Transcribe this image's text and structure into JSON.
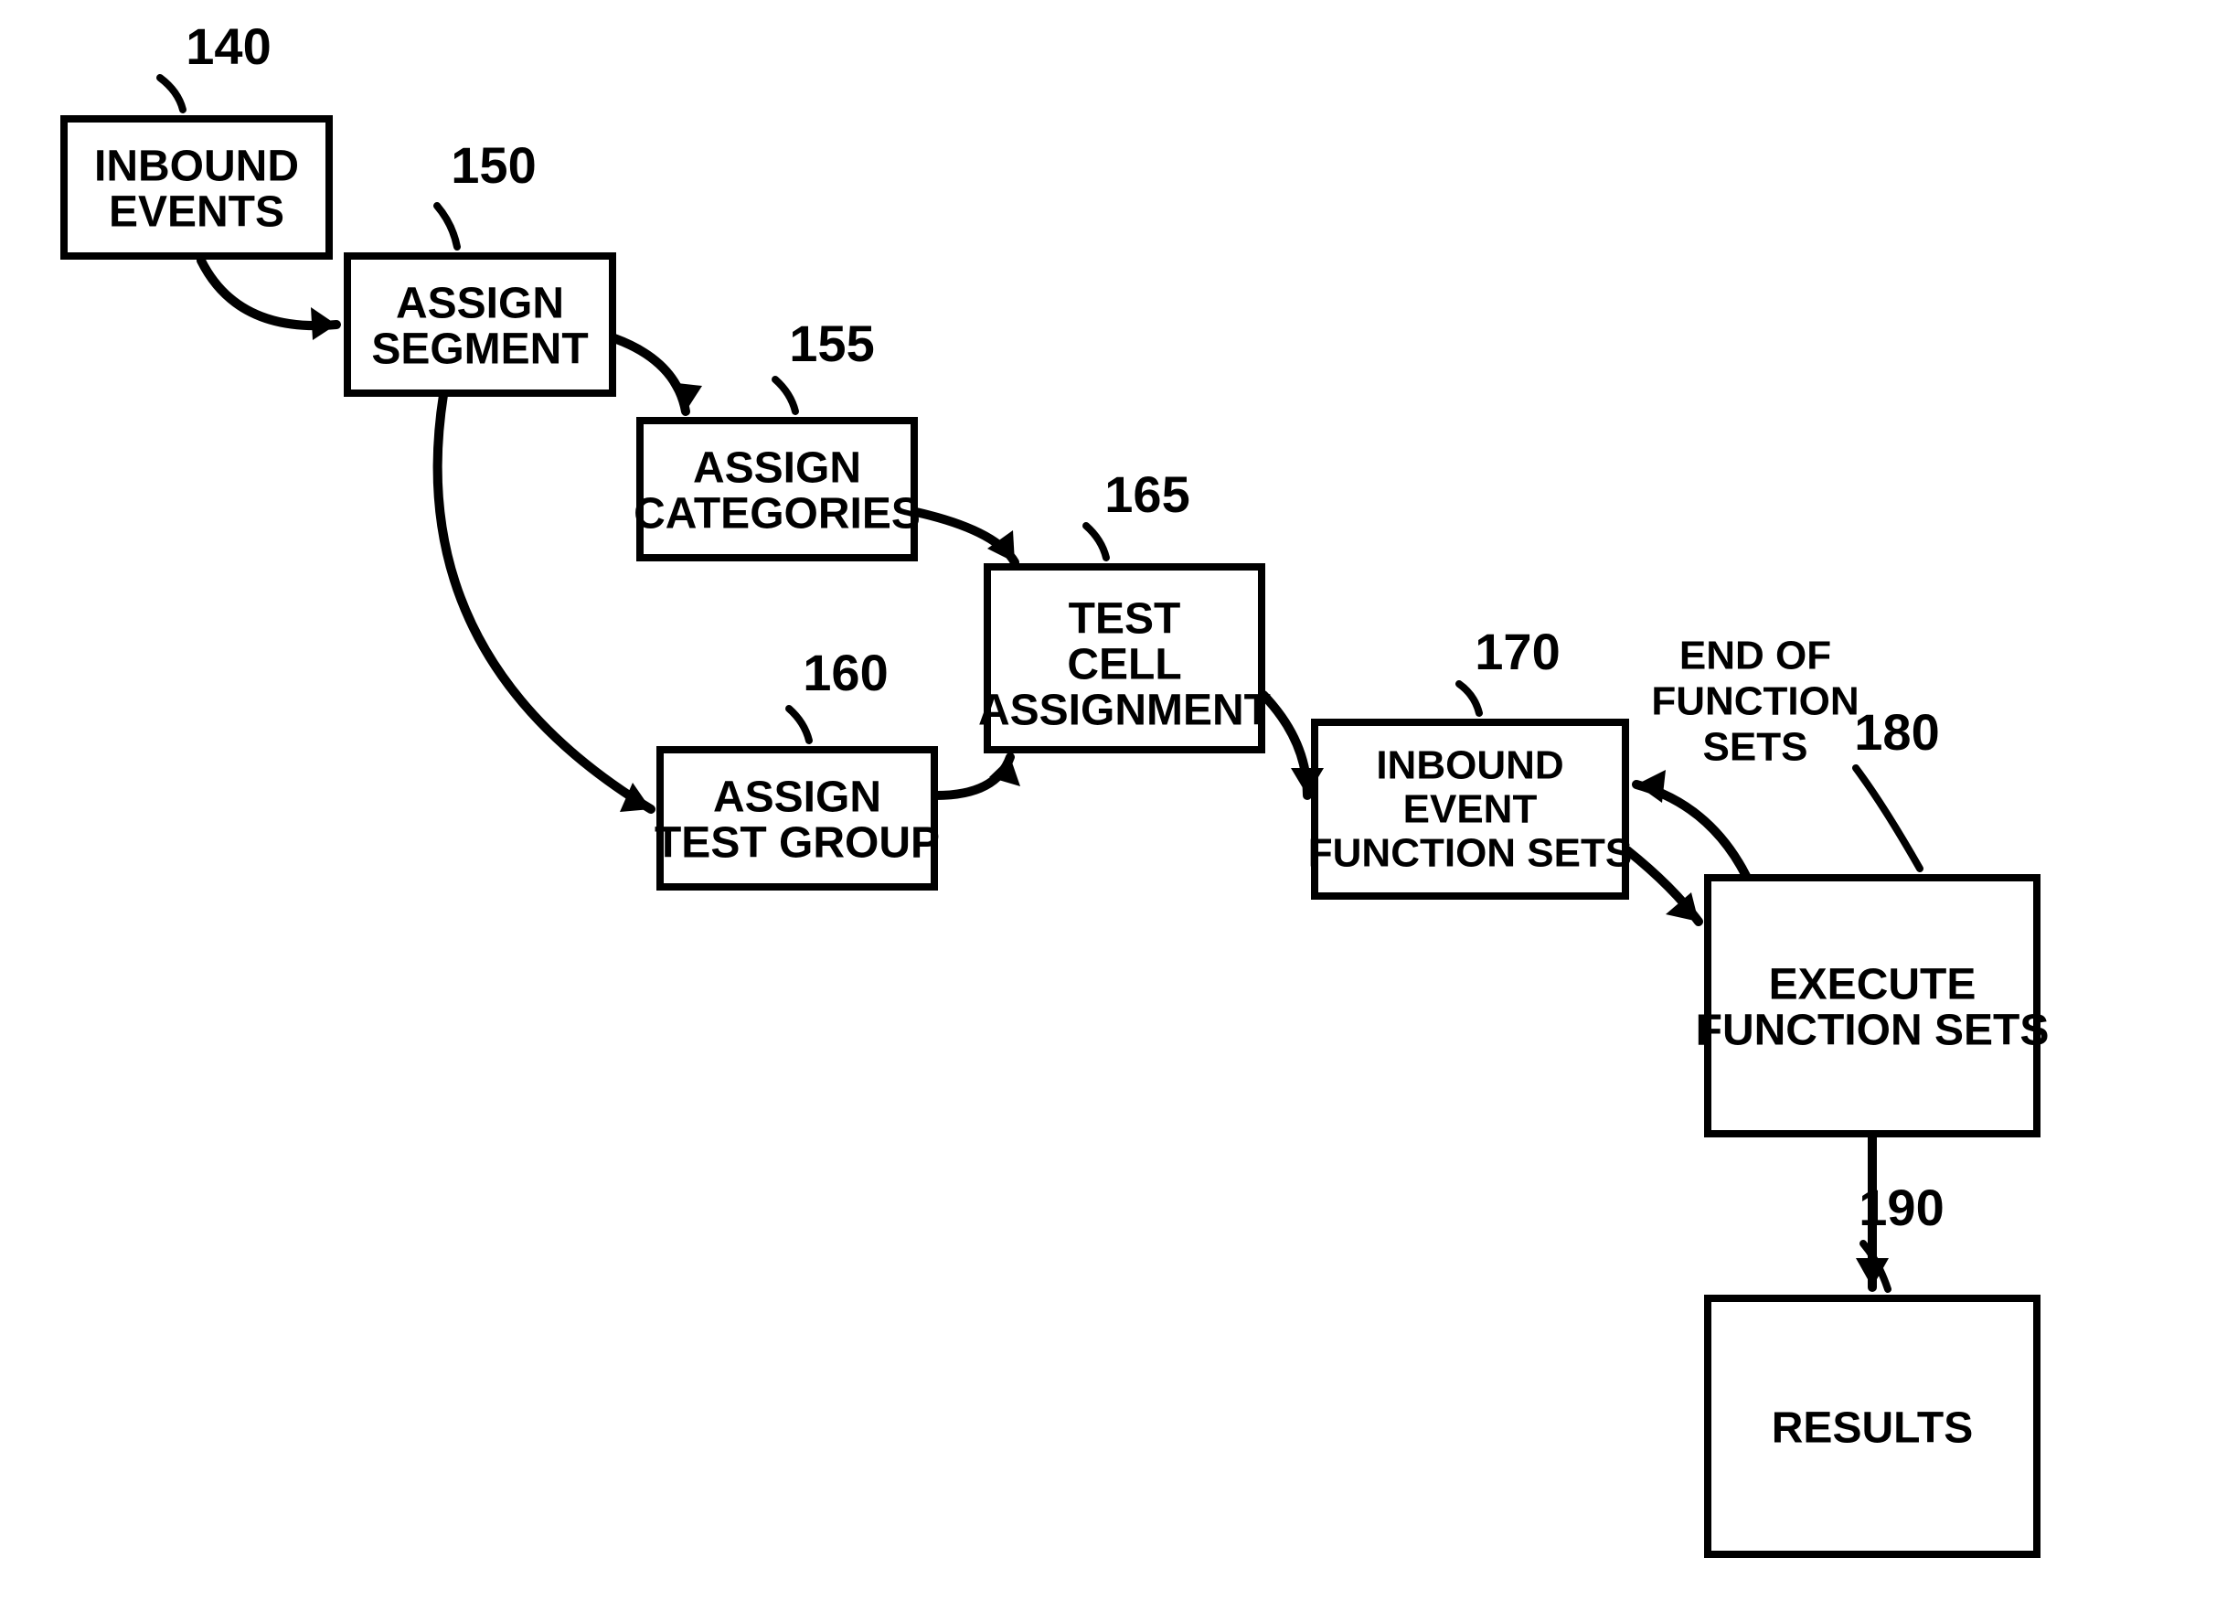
{
  "nodes": {
    "n140": {
      "ref": "140",
      "text": [
        "INBOUND",
        "EVENTS"
      ]
    },
    "n150": {
      "ref": "150",
      "text": [
        "ASSIGN",
        "SEGMENT"
      ]
    },
    "n155": {
      "ref": "155",
      "text": [
        "ASSIGN",
        "CATEGORIES"
      ]
    },
    "n160": {
      "ref": "160",
      "text": [
        "ASSIGN",
        "TEST GROUP"
      ]
    },
    "n165": {
      "ref": "165",
      "text": [
        "TEST",
        "CELL",
        "ASSIGNMENT"
      ]
    },
    "n170": {
      "ref": "170",
      "text": [
        "INBOUND",
        "EVENT",
        "FUNCTION SETS"
      ]
    },
    "n180": {
      "ref": "180",
      "text": [
        "EXECUTE",
        "FUNCTION SETS"
      ]
    },
    "n190": {
      "ref": "190",
      "text": [
        "RESULTS"
      ]
    }
  },
  "edgeLabel": [
    "END OF",
    "FUNCTION",
    "SETS"
  ]
}
